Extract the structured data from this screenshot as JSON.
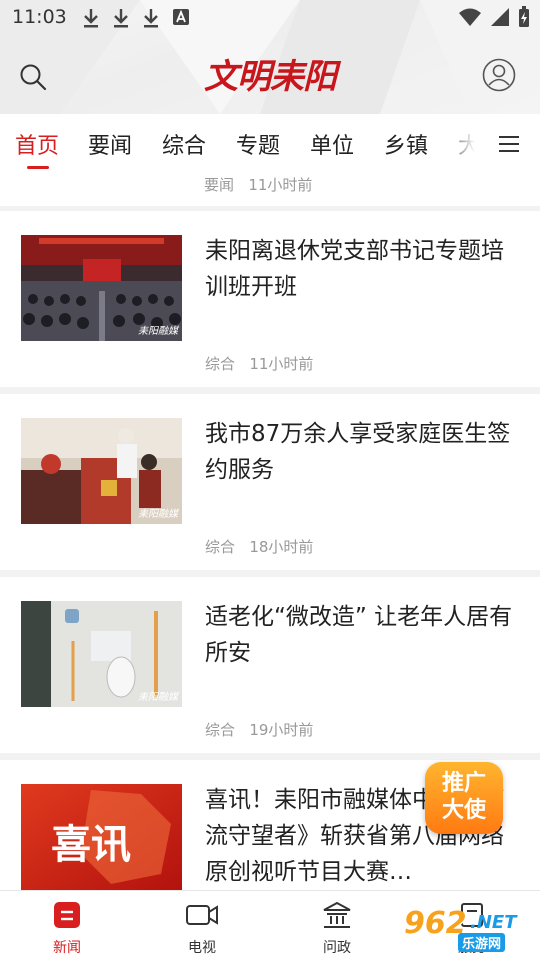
{
  "status_bar": {
    "time": "11:03"
  },
  "header": {
    "logo_text": "文明耒阳"
  },
  "tabs": [
    {
      "label": "首页",
      "active": true
    },
    {
      "label": "要闻"
    },
    {
      "label": "综合"
    },
    {
      "label": "专题"
    },
    {
      "label": "单位"
    },
    {
      "label": "乡镇"
    },
    {
      "label": "大"
    }
  ],
  "previous_item_meta": {
    "category": "要闻",
    "time": "11小时前"
  },
  "articles": [
    {
      "title": "耒阳离退休党支部书记专题培训班开班",
      "category": "综合",
      "time": "11小时前",
      "thumb_watermark": "耒阳融媒"
    },
    {
      "title": "我市87万余人享受家庭医生签约服务",
      "category": "综合",
      "time": "18小时前",
      "thumb_watermark": "耒阳融媒"
    },
    {
      "title": "适老化“微改造” 让老年人居有所安",
      "category": "综合",
      "time": "19小时前",
      "thumb_watermark": "耒阳融媒"
    },
    {
      "title": "喜讯！耒阳市融媒体中心《河流守望者》斩获省第八届网络原创视听节目大赛…",
      "thumb_text": "喜讯"
    }
  ],
  "promo": {
    "line1": "推广",
    "line2": "大使"
  },
  "bottom_nav": [
    {
      "label": "新闻",
      "active": true
    },
    {
      "label": "电视"
    },
    {
      "label": "问政"
    },
    {
      "label": "服务"
    }
  ],
  "watermark": {
    "brand": "962",
    "suffix": ".NET",
    "caption": "乐游网"
  },
  "colors": {
    "accent": "#d81e1e",
    "promo": "#ff8a1a",
    "meta": "#999999"
  }
}
